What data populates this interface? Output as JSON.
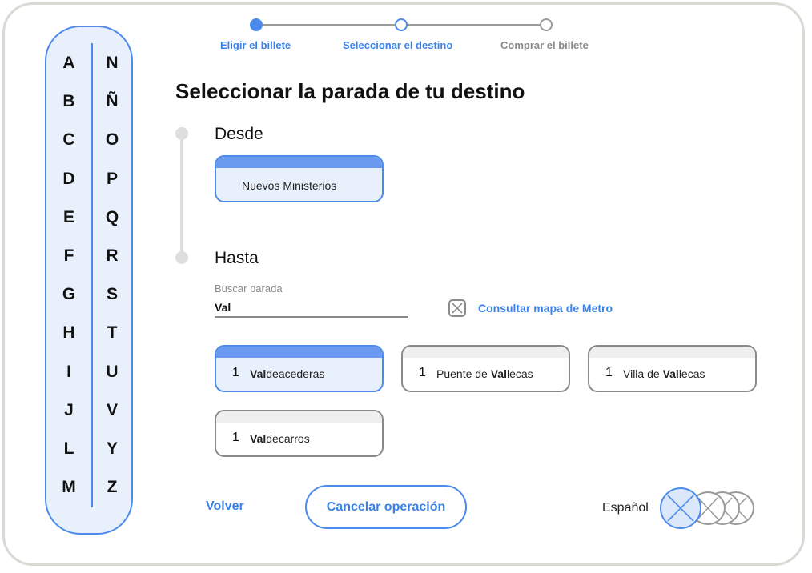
{
  "stepper": {
    "steps": [
      {
        "label": "Eligir el billete",
        "state": "done"
      },
      {
        "label": "Seleccionar el destino",
        "state": "current"
      },
      {
        "label": "Comprar el billete",
        "state": "pending"
      }
    ]
  },
  "alphabet": {
    "left": [
      "A",
      "B",
      "C",
      "D",
      "E",
      "F",
      "G",
      "H",
      "I",
      "J",
      "L",
      "M"
    ],
    "right": [
      "N",
      "Ñ",
      "O",
      "P",
      "Q",
      "R",
      "S",
      "T",
      "U",
      "V",
      "Y",
      "Z"
    ]
  },
  "title": "Seleccionar la parada de tu destino",
  "from": {
    "label": "Desde",
    "station": "Nuevos Ministerios"
  },
  "to": {
    "label": "Hasta",
    "search_label": "Buscar parada",
    "search_value": "Val",
    "map_link": "Consultar mapa de Metro"
  },
  "results": [
    {
      "line": "1",
      "prefix": "",
      "match": "Val",
      "suffix": "deacederas",
      "selected": true
    },
    {
      "line": "1",
      "prefix": "Puente de ",
      "match": "Val",
      "suffix": "lecas",
      "selected": false
    },
    {
      "line": "1",
      "prefix": "Villa de ",
      "match": "Val",
      "suffix": "lecas",
      "selected": false
    },
    {
      "line": "1",
      "prefix": "",
      "match": "Val",
      "suffix": "decarros",
      "selected": false
    }
  ],
  "footer": {
    "back": "Volver",
    "cancel": "Cancelar operación",
    "language": "Español"
  },
  "colors": {
    "accent": "#4c8bea",
    "accent_light": "#e8f0fb",
    "neutral": "#8a8a8a"
  }
}
